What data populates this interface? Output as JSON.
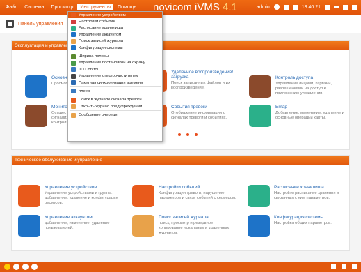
{
  "menubar": {
    "items": [
      "Файл",
      "Система",
      "Просмотр",
      "Инструменты",
      "Помощь"
    ],
    "active_index": 3
  },
  "app": {
    "name": "novicom iVMS",
    "version": "4.1"
  },
  "top_right": {
    "user": "admin",
    "time": "13:40:21"
  },
  "tab": {
    "label": "Панель управления"
  },
  "panels": {
    "operation": {
      "header": "Эксплуатация и управление",
      "cards": [
        {
          "title": "Основной ракурс",
          "desc": "Просмотр видео с камер.",
          "icon": "monitor-icon",
          "color": "#1e73c8"
        },
        {
          "title": "Удаленное воспроизведение/загрузка",
          "desc": "Поиск записанных файлов и их воспроизведение.",
          "icon": "playback-icon",
          "color": "#e85a1c"
        },
        {
          "title": "Контроль доступа",
          "desc": "Управление лицами, картами, разрешениями на доступ к приложению управления.",
          "icon": "door-icon",
          "color": "#8b4a2c"
        },
        {
          "title": "Мониторинг",
          "desc": "Осуществление контроля двери, сигнализации, просмотр проведения контроля.",
          "icon": "door-monitor-icon",
          "color": "#8b4a2c"
        },
        {
          "title": "События тревоги",
          "desc": "Отображение информации о сигналах тревоги и событиях.",
          "icon": "alarm-icon",
          "color": "#e85a1c"
        },
        {
          "title": "Emap",
          "desc": "Добавление, изменение, удаление и основные операции карты.",
          "icon": "map-icon",
          "color": "#2bb08a"
        }
      ]
    },
    "maintenance": {
      "header": "Техническое обслуживание и управление",
      "cards": [
        {
          "title": "Управление устройством",
          "desc": "Управление устройствами и группы: добавление, удаление и конфигурация ресурсов.",
          "icon": "device-manage-icon",
          "color": "#e85a1c"
        },
        {
          "title": "Настройки событий",
          "desc": "Конфигурация тревоги, нарушение параметров и связи событий с сервером.",
          "icon": "event-settings-icon",
          "color": "#e85a1c"
        },
        {
          "title": "Расписание хранилища",
          "desc": "Настройте расписание хранения и связанных с ним параметров.",
          "icon": "storage-schedule-icon",
          "color": "#2bb08a"
        },
        {
          "title": "Управление аккаунтом",
          "desc": "добавление, изменение, удаление пользователей.",
          "icon": "account-icon",
          "color": "#1e73c8"
        },
        {
          "title": "Поиск записей журнала",
          "desc": "поиск, просмотр и резервное копирование локальных и удаленных журналов.",
          "icon": "log-search-icon",
          "color": "#e8a24a"
        },
        {
          "title": "Конфигурация системы",
          "desc": "Настройка общих параметров.",
          "icon": "system-config-icon",
          "color": "#1e73c8"
        }
      ]
    }
  },
  "dropdown": {
    "items": [
      {
        "label": "Управление устройством",
        "icon": "device-icon",
        "color": "#e85a1c",
        "selected": true
      },
      {
        "label": "Настройки событий",
        "icon": "event-icon",
        "color": "#d04040"
      },
      {
        "label": "Расписание хранилища",
        "icon": "storage-icon",
        "color": "#2bb08a"
      },
      {
        "label": "Управление аккаунтом",
        "icon": "account-icon",
        "color": "#1e73c8"
      },
      {
        "label": "Поиск записей журнала",
        "icon": "log-icon",
        "color": "#e8a24a"
      },
      {
        "label": "Конфигурация системы",
        "icon": "gear-icon",
        "color": "#1e73c8"
      },
      {
        "sep": true
      },
      {
        "label": "Ширина полосы",
        "icon": "bandwidth-icon",
        "color": "#5a8a30"
      },
      {
        "label": "Управление постановкой на охрану",
        "icon": "arm-icon",
        "color": "#4a9a4a"
      },
      {
        "label": "I/O Control",
        "icon": "io-icon",
        "color": "#3a7ac0"
      },
      {
        "label": "Управление стеклоочистителем",
        "icon": "wiper-icon",
        "color": "#444444"
      },
      {
        "label": "Пакетная синхронизация времени",
        "icon": "clock-icon",
        "color": "#2a6ab3"
      },
      {
        "sep": true
      },
      {
        "label": "плеер",
        "icon": "player-icon",
        "color": "#3a7ac0"
      },
      {
        "sep": true
      },
      {
        "label": "Поиск в журнале сигнала тревоги",
        "icon": "alarm-log-icon",
        "color": "#e85a1c"
      },
      {
        "label": "Открыть журнал предупреждений",
        "icon": "warning-log-icon",
        "color": "#e8a24a"
      },
      {
        "sep": true
      },
      {
        "label": "Сообщение очереди",
        "icon": "message-icon",
        "color": "#e8a24a"
      }
    ]
  }
}
